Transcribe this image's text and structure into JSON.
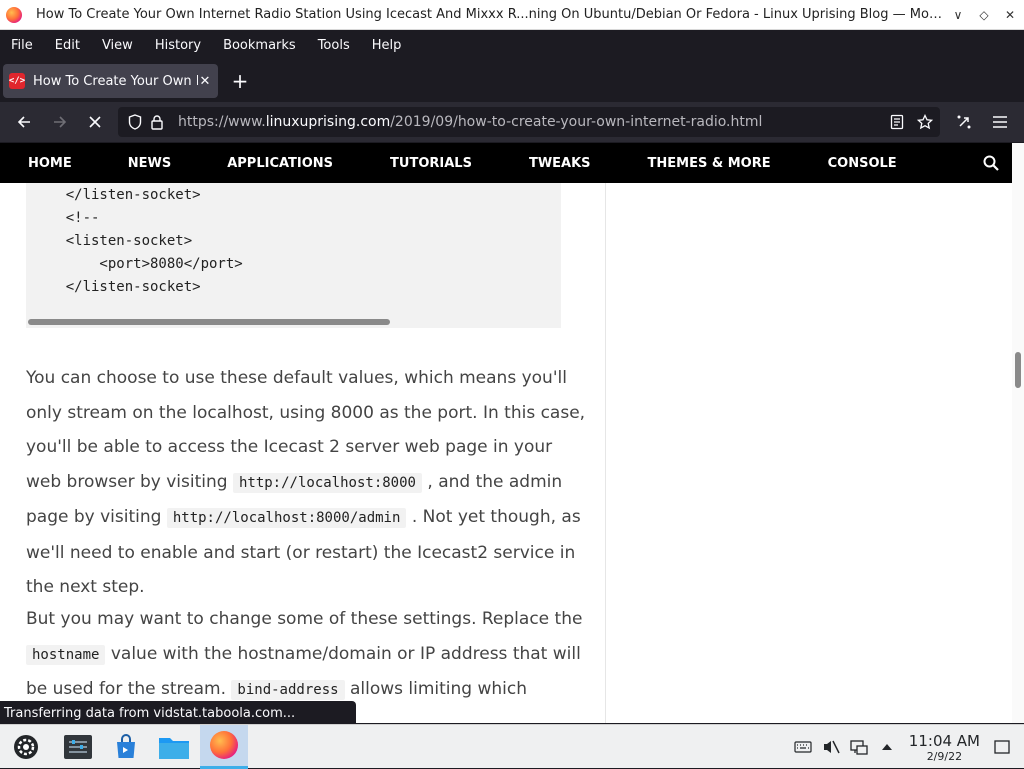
{
  "window": {
    "title": "How To Create Your Own Internet Radio Station Using Icecast And Mixxx R...ning On Ubuntu/Debian Or Fedora - Linux Uprising Blog — Mozilla Firefox",
    "minimize": "∨",
    "maximize": "◇",
    "close": "✕"
  },
  "menu": [
    "File",
    "Edit",
    "View",
    "History",
    "Bookmarks",
    "Tools",
    "Help"
  ],
  "tab": {
    "label": "How To Create Your Own Ir",
    "favicon": "</>",
    "close": "✕"
  },
  "newtab": "+",
  "nav": {
    "url_prefix": "https://www.",
    "url_domain": "linuxuprising.com",
    "url_path": "/2019/09/how-to-create-your-own-internet-radio.html"
  },
  "site_nav": [
    "HOME",
    "NEWS",
    "APPLICATIONS",
    "TUTORIALS",
    "TWEAKS",
    "THEMES & MORE",
    "CONSOLE"
  ],
  "code_lines": [
    "    </listen-socket>",
    "    <!--",
    "    <listen-socket>",
    "        <port>8080</port>",
    "    </listen-socket>"
  ],
  "para1": {
    "t1": "You can choose to use these default values, which means you'll only stream on the localhost, using 8000 as the port. In this case, you'll be able to access the Icecast 2 server web page in your web browser by visiting ",
    "c1": "http://localhost:8000",
    "t2": " , and the admin page by visiting ",
    "c2": "http://localhost:8000/admin",
    "t3": " . Not yet though, as we'll need to enable and start (or restart) the Icecast2 service in the next step."
  },
  "para2": {
    "t1": "But you may want to change some of these settings. Replace the ",
    "c1": "hostname",
    "t2": "  value with the hostname/domain or IP address that will be used for the stream. ",
    "c2": "bind-address",
    "t3": "  allows limiting which addresses ... ot specified (this is the"
  },
  "status": "Transferring data from vidstat.taboola.com...",
  "clock": {
    "time": "11:04 AM",
    "date": "2/9/22"
  },
  "colors": {
    "accent": "#3daee9",
    "tab_favicon": "#e0262d"
  }
}
